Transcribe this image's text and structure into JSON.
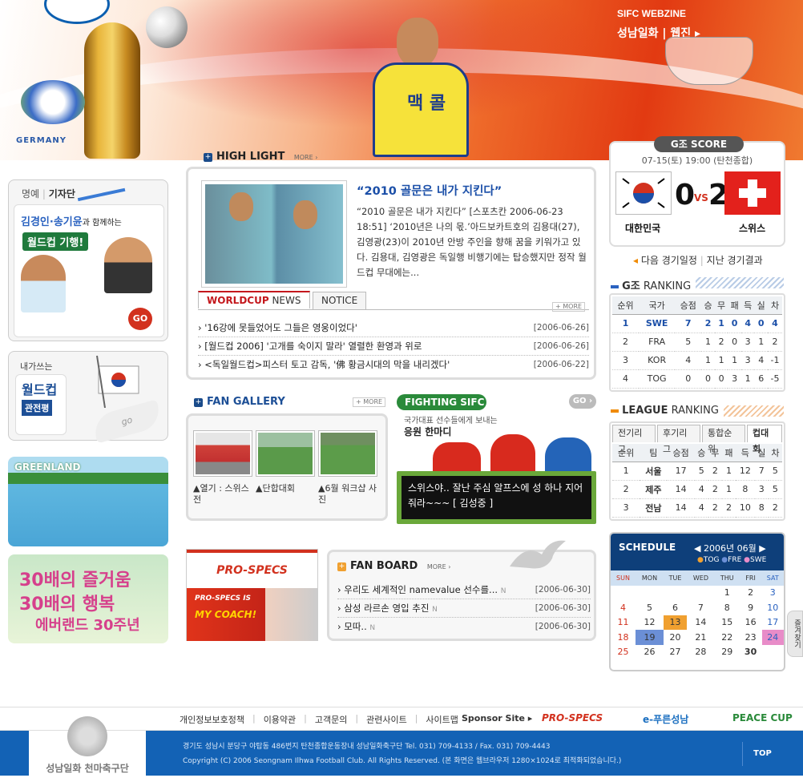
{
  "header": {
    "webzine_en": "SIFC WEBZINE",
    "webzine_ko": "성남일화 | 웹진 ▸",
    "wc_logo_text": "GERMANY",
    "player_jersey": "맥 콜"
  },
  "left": {
    "honor_title": "명예",
    "honor_sub": "기자단",
    "honor_line1": "김경인·송기윤",
    "honor_line1b": "과 함께하는",
    "honor_line2": "월드컵 기행!",
    "go_label": "GO",
    "review_top": "내가쓰는",
    "review_title": "월드컵",
    "review_btn": "관전평",
    "greenland": "GREENLAND",
    "everland_1": "30배의 즐거움",
    "everland_2": "30배의 행복",
    "everland_3": "에버랜드 30주년"
  },
  "highlight": {
    "title": "HIGH LIGHT",
    "more": "MORE ›",
    "headline": "“2010 골문은 내가 지킨다”",
    "body": "“2010 골문은 내가 지킨다” [스포츠칸 2006-06-23 18:51] ‘2010년은 나의 몫.’아드보카트호의 김용대(27), 김영광(23)이 2010년 안방 주인을 향해 꿈을 키워가고 있다. 김용대, 김영광은 독일행 비행기에는 탑승했지만 정작 월드컵 무대에는..."
  },
  "news": {
    "tab_active_1": "WORLDCUP",
    "tab_active_2": " NEWS",
    "tab_notice": "NOTICE",
    "more": "+ MORE",
    "items": [
      {
        "title": "'16강에 못들었어도 그들은 영웅이었다'",
        "date": "[2006-06-26]"
      },
      {
        "title": "[월드컵 2006] '고개를 숙이지 말라' 열렬한 환영과 위로",
        "date": "[2006-06-26]"
      },
      {
        "title": "<독일월드컵>피스터 토고 감독, '佛 황금시대의 막을 내리겠다'",
        "date": "[2006-06-22]"
      }
    ]
  },
  "gallery": {
    "title": "FAN GALLERY",
    "more": "+ MORE",
    "items": [
      {
        "caption": "▲열기 : 스위스 전"
      },
      {
        "caption": "▲단합대회"
      },
      {
        "caption": "▲6월 워크샵 사진"
      }
    ]
  },
  "fighting": {
    "title": "FIGHTING SIFC",
    "go": "GO ›",
    "sub1": "국가대표 선수들에게 보내는",
    "sub2": "응원 한마디",
    "message": "스위스야.. 잘난 주심 알프스에 성 하나 지어줘라~~~ [ 김성중 ]"
  },
  "prospecs": {
    "brand": "PRO-SPECS",
    "line1": "PRO-SPECS IS",
    "line2": "MY COACH!"
  },
  "fanboard": {
    "title": "FAN BOARD",
    "more": "MORE ›",
    "items": [
      {
        "title": "우리도 세계적인 namevalue 선수를...",
        "date": "[2006-06-30]"
      },
      {
        "title": "삼성 라르손 영입 추진",
        "date": "[2006-06-30]"
      },
      {
        "title": "모따..",
        "date": "[2006-06-30]"
      }
    ]
  },
  "score": {
    "title": "G조 SCORE",
    "datetime": "07-15(토) 19:00 (탄천종합)",
    "home_team": "대한민국",
    "away_team": "스위스",
    "home_score": "0",
    "vs": "VS",
    "away_score": "2",
    "next_link": "다음 경기일정",
    "prev_link": "지난 경기결과"
  },
  "g_ranking": {
    "title_1": "G조",
    "title_2": " RANKING",
    "headers": [
      "순위",
      "국가",
      "승점",
      "승",
      "무",
      "패",
      "득",
      "실",
      "차"
    ],
    "rows": [
      [
        "1",
        "SWE",
        "7",
        "2",
        "1",
        "0",
        "4",
        "0",
        "4"
      ],
      [
        "2",
        "FRA",
        "5",
        "1",
        "2",
        "0",
        "3",
        "1",
        "2"
      ],
      [
        "3",
        "KOR",
        "4",
        "1",
        "1",
        "1",
        "3",
        "4",
        "-1"
      ],
      [
        "4",
        "TOG",
        "0",
        "0",
        "0",
        "3",
        "1",
        "6",
        "-5"
      ]
    ]
  },
  "league_ranking": {
    "title_1": "LEAGUE",
    "title_2": " RANKING",
    "tabs": [
      "전기리그",
      "후기리그",
      "통합순위",
      "컵대회"
    ],
    "headers": [
      "순위",
      "팀",
      "승점",
      "승",
      "무",
      "패",
      "득",
      "실",
      "차"
    ],
    "rows": [
      [
        "1",
        "서울",
        "17",
        "5",
        "2",
        "1",
        "12",
        "7",
        "5"
      ],
      [
        "2",
        "제주",
        "14",
        "4",
        "2",
        "1",
        "8",
        "3",
        "5"
      ],
      [
        "3",
        "전남",
        "14",
        "4",
        "2",
        "2",
        "10",
        "8",
        "2"
      ]
    ]
  },
  "schedule": {
    "title": "SCHEDULE",
    "month": "2006년 06월",
    "legend": [
      "TOG",
      "FRE",
      "SWE"
    ],
    "days": [
      "SUN",
      "MON",
      "TUE",
      "WED",
      "THU",
      "FRI",
      "SAT"
    ],
    "weeks": [
      [
        "",
        "",
        "",
        "",
        "1",
        "2",
        "3"
      ],
      [
        "4",
        "5",
        "6",
        "7",
        "8",
        "9",
        "10"
      ],
      [
        "11",
        "12",
        "13",
        "14",
        "15",
        "16",
        "17"
      ],
      [
        "18",
        "19",
        "20",
        "21",
        "22",
        "23",
        "24"
      ],
      [
        "25",
        "26",
        "27",
        "28",
        "29",
        "30",
        ""
      ]
    ],
    "side_tab": "즐겨찾기",
    "colors": {
      "tog": "#f0a030",
      "fre": "#6b8fd6",
      "swe": "#e88cc8"
    }
  },
  "footer": {
    "links": [
      "개인정보보호정책",
      "이용약관",
      "고객문의",
      "관련사이트",
      "사이트맵"
    ],
    "sponsor": "Sponsor Site ▸",
    "sponsors": [
      "PRO-SPECS",
      "e-푸른성남",
      "PEACE CUP"
    ],
    "club_name": "성남일화 천마축구단",
    "address": "경기도 성남시 분당구 야탑동 486번지 탄천종합운동장내 성남일화축구단  Tel. 031) 709-4133 / Fax. 031) 709-4443",
    "copyright": "Copyright (C) 2006  Seongnam Ilhwa Football Club. All Rights Reserved. (본 화면은 웹브라우저 1280×1024로 최적화되었습니다.)",
    "top": "TOP"
  }
}
